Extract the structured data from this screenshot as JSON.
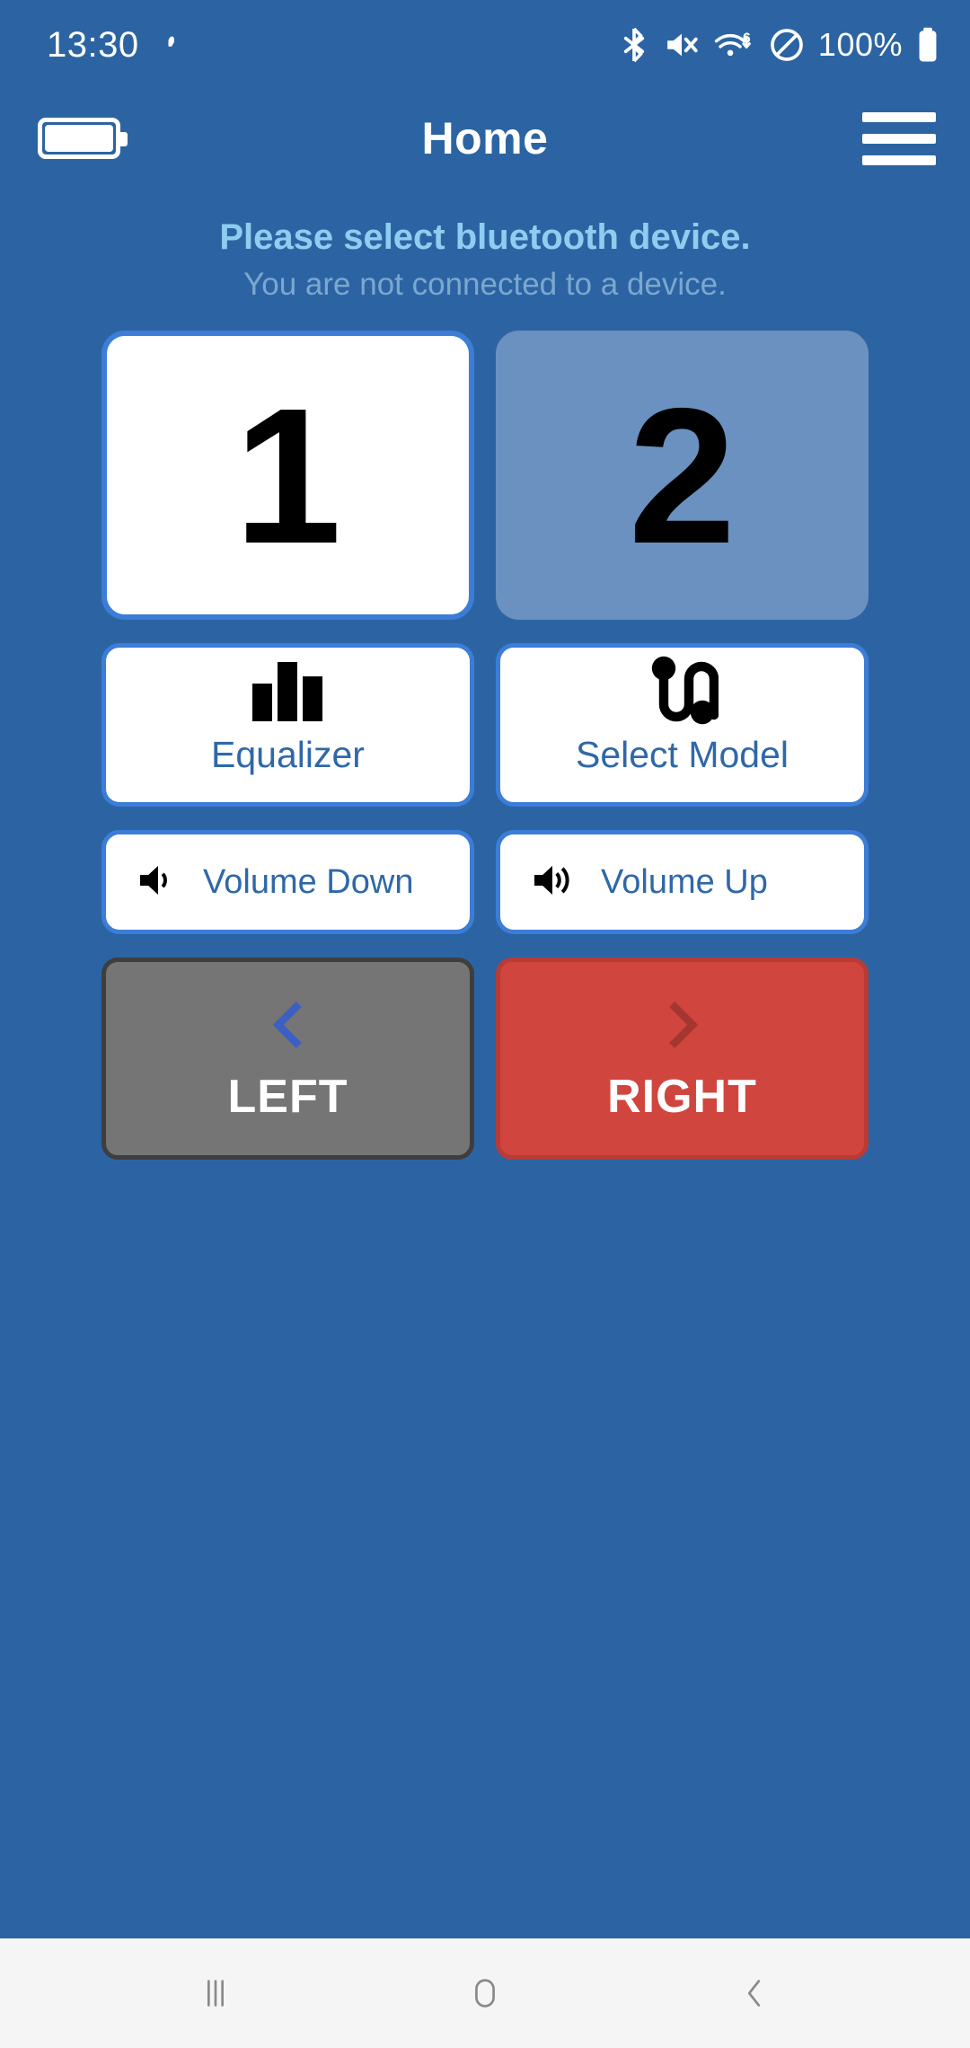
{
  "status_bar": {
    "time": "13:30",
    "battery_percent": "100%",
    "icons": [
      "fan-icon",
      "bluetooth-icon",
      "volume-muted-icon",
      "wifi-6-icon",
      "do-not-disturb-icon",
      "battery-full-icon"
    ]
  },
  "app_bar": {
    "title": "Home",
    "battery_icon": "battery-full-horizontal-icon",
    "menu_icon": "hamburger-menu-icon"
  },
  "messages": {
    "primary": "Please select bluetooth device.",
    "secondary": "You are not connected to a device."
  },
  "tiles": [
    {
      "label": "1",
      "state": "selected"
    },
    {
      "label": "2",
      "state": "disabled"
    }
  ],
  "actions": [
    {
      "label": "Equalizer",
      "icon": "equalizer-bars-icon"
    },
    {
      "label": "Select Model",
      "icon": "headphone-curve-icon"
    }
  ],
  "volume": [
    {
      "label": "Volume Down",
      "icon": "volume-down-icon"
    },
    {
      "label": "Volume Up",
      "icon": "volume-up-icon"
    }
  ],
  "direction": [
    {
      "label": "LEFT",
      "icon": "chevron-left-icon",
      "state": "inactive"
    },
    {
      "label": "RIGHT",
      "icon": "chevron-right-icon",
      "state": "active"
    }
  ],
  "nav_bar": {
    "recents": "recents-icon",
    "home": "home-icon",
    "back": "back-icon"
  },
  "colors": {
    "background": "#2c64a3",
    "accent_border": "#3b7dd8",
    "label_blue": "#2f68a8",
    "message_primary": "#8fcdf0",
    "message_secondary": "#7ba8cf",
    "tile_disabled": "#6a91bf",
    "left_button": "#757575",
    "right_button": "#d1453f",
    "nav_bar": "#f5f5f5"
  }
}
